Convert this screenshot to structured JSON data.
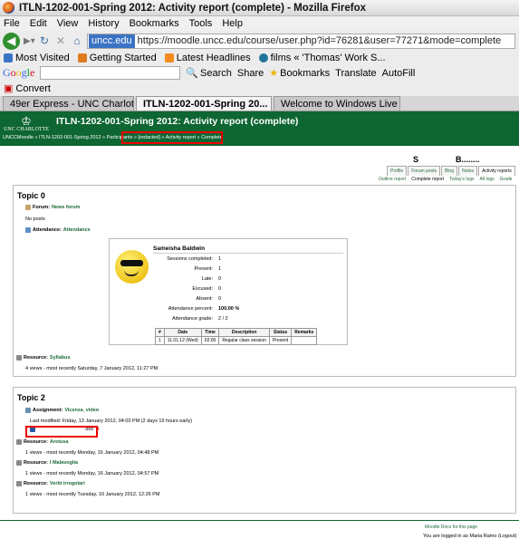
{
  "window": {
    "title": "ITLN-1202-001-Spring 2012: Activity report (complete) - Mozilla Firefox"
  },
  "menu": [
    "File",
    "Edit",
    "View",
    "History",
    "Bookmarks",
    "Tools",
    "Help"
  ],
  "nav": {
    "site_badge": "uncc.edu",
    "url": "https://moodle.uncc.edu/course/user.php?id=76281&user=77271&mode=complete"
  },
  "bookmarks": [
    "Most Visited",
    "Getting Started",
    "Latest Headlines",
    "films « 'Thomas' Work S..."
  ],
  "google_toolbar": {
    "logo": "Google",
    "search": "Search",
    "share": "Share",
    "bookmarks": "Bookmarks",
    "translate": "Translate",
    "autofill": "AutoFill"
  },
  "convert": "Convert",
  "tabs": [
    {
      "label": "49er Express - UNC Charlotte",
      "active": false
    },
    {
      "label": "ITLN-1202-001-Spring 20...",
      "active": true
    },
    {
      "label": "Welcome to Windows Live",
      "active": false
    }
  ],
  "header": {
    "logo": "UNC CHARLOTTE",
    "course_title": "ITLN-1202-001-Spring 2012: Activity report (complete)",
    "breadcrumbs": "UNCCMoodle » ITLN-1202-001-Spring 2012 » Participants » [redacted] » Activity report » Complete"
  },
  "profile": {
    "first_initial": "S",
    "last_initial": "B........",
    "tabs": [
      "Profile",
      "Forum posts",
      "Blog",
      "Notes",
      "Activity reports"
    ],
    "active_tab": "Activity reports",
    "subtabs": [
      "Outline report",
      "Complete report",
      "Today's logs",
      "All logs",
      "Grade"
    ],
    "current_subtab": "Complete report"
  },
  "topic0": {
    "title": "Topic 0",
    "forum_label": "Forum:",
    "forum_name": "News forum",
    "forum_posts": "No posts",
    "attendance_label": "Attendance:",
    "attendance_name": "Attendance",
    "student_name": "Sameisha Baldwin",
    "stats": [
      {
        "label": "Sessions completed:",
        "value": "1"
      },
      {
        "label": "Present:",
        "value": "1"
      },
      {
        "label": "Late:",
        "value": "0"
      },
      {
        "label": "Excused:",
        "value": "0"
      },
      {
        "label": "Absent:",
        "value": "0"
      },
      {
        "label": "Attendance percent:",
        "value": "100.00 %"
      },
      {
        "label": "Attendance grade:",
        "value": "2 / 2"
      }
    ],
    "session_table": {
      "headers": [
        "#",
        "Date",
        "Time",
        "Description",
        "Status",
        "Remarks"
      ],
      "rows": [
        [
          "1",
          "11.01.12 (Wed)",
          "02:00",
          "Regular class session",
          "Present",
          ""
        ]
      ]
    },
    "resource_label": "Resource:",
    "resource_name": "Syllabus",
    "resource_views": "4 views - most recently Saturday, 7 January 2012, 11:27 PM"
  },
  "topic2": {
    "title": "Topic 2",
    "assignment_label": "Assignment:",
    "assignment_name": "Vicenza_video",
    "assignment_modified": "Last modified: Friday, 13 January 2012, 04:03 PM (2 days 19 hours early)",
    "file_name": ".doc",
    "items": [
      {
        "label": "Resource:",
        "name": "Aretusa",
        "views": "1 views - most recently Monday, 16 January 2012, 04:48 PM"
      },
      {
        "label": "Resource:",
        "name": "I Malavoglia",
        "views": "1 views - most recently Monday, 16 January 2012, 04:57 PM"
      },
      {
        "label": "Resource:",
        "name": "Verbi irregolari",
        "views": "1 views - most recently Tuesday, 10 January 2012, 12:26 PM"
      }
    ]
  },
  "footer": {
    "docs": "Moodle Docs for this page",
    "logged_in": "You are logged in as Maria Ramo (Logout)"
  }
}
